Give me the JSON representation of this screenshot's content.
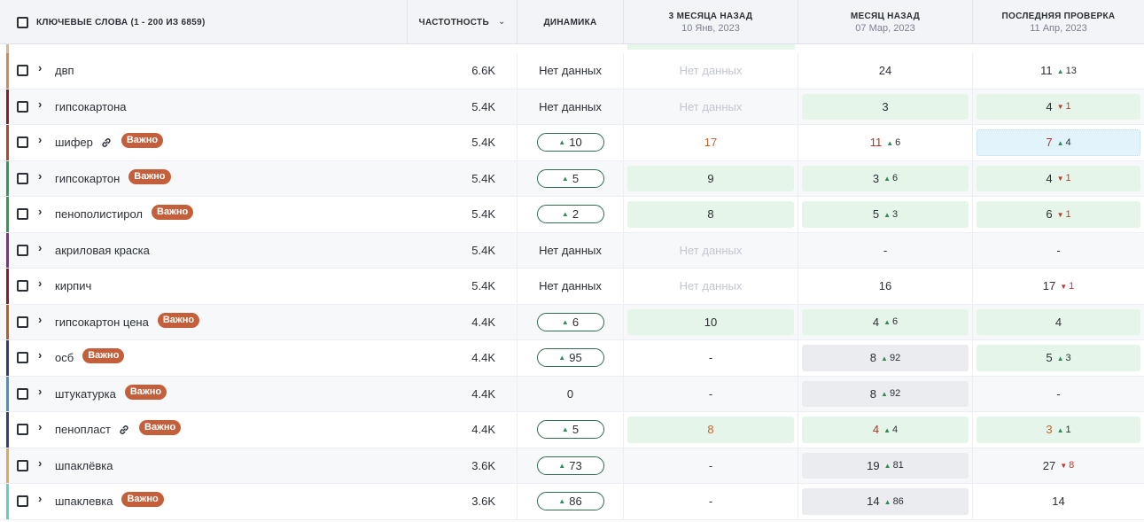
{
  "header": {
    "keywords": "КЛЮЧЕВЫЕ СЛОВА (1 - 200 ИЗ 6859)",
    "frequency": "ЧАСТОТНОСТЬ",
    "dynamics": "ДИНАМИКА",
    "m3": {
      "label": "3 МЕСЯЦА НАЗАД",
      "date": "10 Янв, 2023"
    },
    "m1": {
      "label": "МЕСЯЦ НАЗАД",
      "date": "07 Мар, 2023"
    },
    "last": {
      "label": "ПОСЛЕДНЯЯ ПРОВЕРКА",
      "date": "11 Апр, 2023"
    }
  },
  "badge_label": "Важно",
  "rows": [
    {
      "kw": "двп",
      "freq": "6.6K",
      "dyn": "Нет данных",
      "m3": "Нет данных",
      "m1": "24",
      "last": "11",
      "last_d": "13"
    },
    {
      "kw": "гипсокартона",
      "freq": "5.4K",
      "dyn": "Нет данных",
      "m3": "Нет данных",
      "m1": "3",
      "last": "4",
      "last_d": "1"
    },
    {
      "kw": "шифер",
      "freq": "5.4K",
      "dyn": "10",
      "m3": "17",
      "m1": "11",
      "m1_d": "6",
      "last": "7",
      "last_d": "4"
    },
    {
      "kw": "гипсокартон",
      "freq": "5.4K",
      "dyn": "5",
      "m3": "9",
      "m1": "3",
      "m1_d": "6",
      "last": "4",
      "last_d": "1"
    },
    {
      "kw": "пенополистирол",
      "freq": "5.4K",
      "dyn": "2",
      "m3": "8",
      "m1": "5",
      "m1_d": "3",
      "last": "6",
      "last_d": "1"
    },
    {
      "kw": "акриловая краска",
      "freq": "5.4K",
      "dyn": "Нет данных",
      "m3": "Нет данных",
      "m1": "-",
      "last": "-"
    },
    {
      "kw": "кирпич",
      "freq": "5.4K",
      "dyn": "Нет данных",
      "m3": "Нет данных",
      "m1": "16",
      "last": "17",
      "last_d": "1"
    },
    {
      "kw": "гипсокартон цена",
      "freq": "4.4K",
      "dyn": "6",
      "m3": "10",
      "m1": "4",
      "m1_d": "6",
      "last": "4"
    },
    {
      "kw": "осб",
      "freq": "4.4K",
      "dyn": "95",
      "m3": "-",
      "m1": "8",
      "m1_d": "92",
      "last": "5",
      "last_d": "3"
    },
    {
      "kw": "штукатурка",
      "freq": "4.4K",
      "dyn": "0",
      "m3": "-",
      "m1": "8",
      "m1_d": "92",
      "last": "-"
    },
    {
      "kw": "пенопласт",
      "freq": "4.4K",
      "dyn": "5",
      "m3": "8",
      "m1": "4",
      "m1_d": "4",
      "last": "3",
      "last_d": "1"
    },
    {
      "kw": "шпаклёвка",
      "freq": "3.6K",
      "dyn": "73",
      "m3": "-",
      "m1": "19",
      "m1_d": "81",
      "last": "27",
      "last_d": "8"
    },
    {
      "kw": "шпаклевка",
      "freq": "3.6K",
      "dyn": "86",
      "m3": "-",
      "m1": "14",
      "m1_d": "86",
      "last": "14"
    }
  ],
  "colors": {
    "important_badge": "#c45f3b",
    "positive_bg": "#e6f5e9",
    "neutral_bg": "#ebecef",
    "highlight_bg": "#e3f3fc",
    "up_arrow": "#2f8a55",
    "down_arrow": "#c0392b"
  }
}
